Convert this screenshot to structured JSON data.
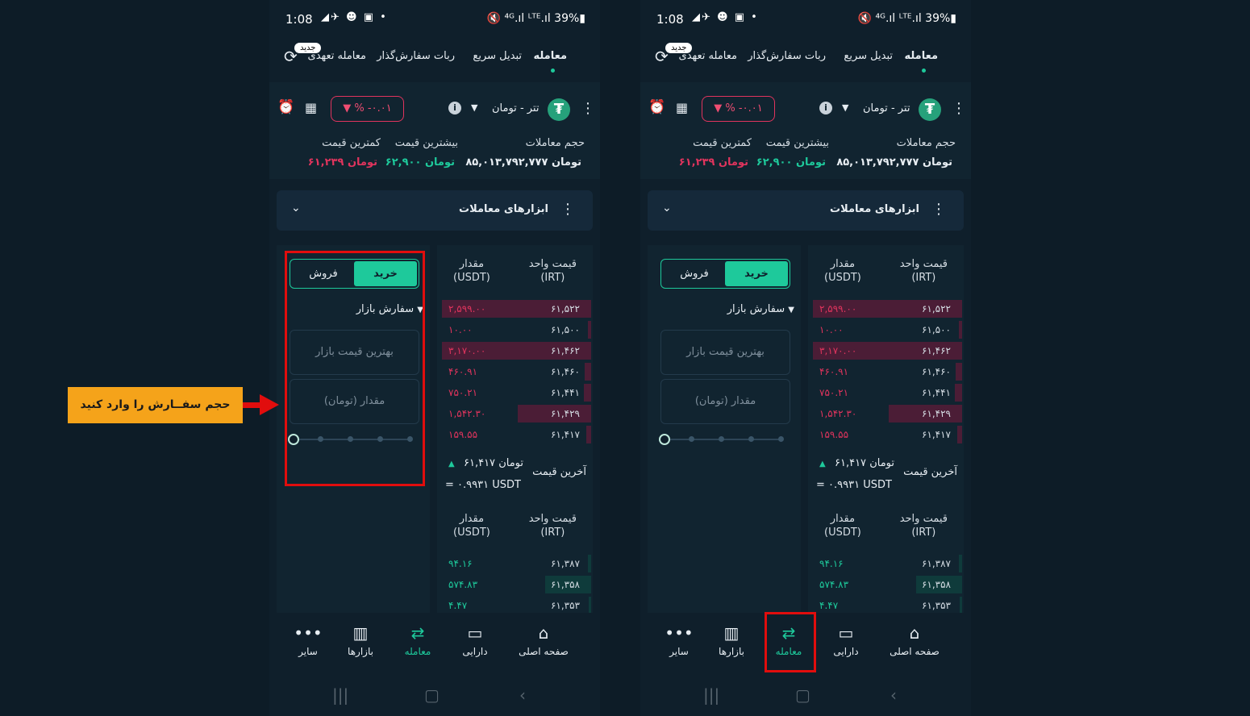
{
  "status": {
    "time": "1:08",
    "icons": "◢✈ ☻ ▣ •",
    "right": "🔇 ⁴ᴳ.ıl ᴸᵀᴱ.ıl 39%▮"
  },
  "tabs": {
    "trade": "معامله",
    "quick": "تبدیل سریع",
    "bot": "ربات سفارش‌گذار",
    "margin": "معامله تعهدی",
    "new_badge": "جدید"
  },
  "header": {
    "pair": "تتر - تومان",
    "change": "▼ % -۰.۰۱",
    "volume_label": "حجم معاملات",
    "volume_value": "۸۵,۰۱۳,۷۹۲,۷۷۷ تومان",
    "high_label": "بیشترین قیمت",
    "high_value": "۶۲,۹۰۰ تومان",
    "low_label": "کمترین قیمت",
    "low_value": "۶۱,۲۳۹ تومان"
  },
  "tools": {
    "title": "ابزارهای معاملات"
  },
  "form": {
    "buy": "خرید",
    "sell": "فروش",
    "order_type": "سفارش بازار",
    "price_placeholder": "بهترین قیمت بازار",
    "amount_placeholder": "مقدار (تومان)"
  },
  "orderbook": {
    "price_header": "قیمت واحد",
    "price_unit": "(IRT)",
    "amount_header": "مقدار",
    "amount_unit": "(USDT)",
    "asks": [
      {
        "price": "۶۱,۵۲۲",
        "amount": "۲,۵۹۹.۰۰",
        "depth": 0.98
      },
      {
        "price": "۶۱,۵۰۰",
        "amount": "۱۰.۰۰",
        "depth": 0.02
      },
      {
        "price": "۶۱,۴۶۲",
        "amount": "۳,۱۷۰.۰۰",
        "depth": 0.98
      },
      {
        "price": "۶۱,۴۶۰",
        "amount": "۴۶۰.۹۱",
        "depth": 0.04
      },
      {
        "price": "۶۱,۴۴۱",
        "amount": "۷۵۰.۲۱",
        "depth": 0.05
      },
      {
        "price": "۶۱,۴۲۹",
        "amount": "۱,۵۴۲.۳۰",
        "depth": 0.48
      },
      {
        "price": "۶۱,۴۱۷",
        "amount": "۱۵۹.۵۵",
        "depth": 0.03
      }
    ],
    "last_title": "آخرین قیمت",
    "last_value": "۶۱,۴۱۷ تومان",
    "last_usdt": "= ۰.۹۹۳۱ USDT",
    "bids": [
      {
        "price": "۶۱,۳۸۷",
        "amount": "۹۴.۱۶",
        "depth": 0.02
      },
      {
        "price": "۶۱,۳۵۸",
        "amount": "۵۷۴.۸۳",
        "depth": 0.3
      },
      {
        "price": "۶۱,۳۵۳",
        "amount": "۴.۴۷",
        "depth": 0.01
      }
    ]
  },
  "nav": {
    "home": "صفحه اصلی",
    "assets": "دارایی",
    "trade": "معامله",
    "markets": "بازارها",
    "more": "سایر"
  },
  "callout": {
    "text": "حجم سفــارش را وارد کنید"
  },
  "colors": {
    "accent": "#1ec99b",
    "sell": "#e0345d",
    "highlight": "#e10d0d",
    "callout": "#f5a31a"
  }
}
